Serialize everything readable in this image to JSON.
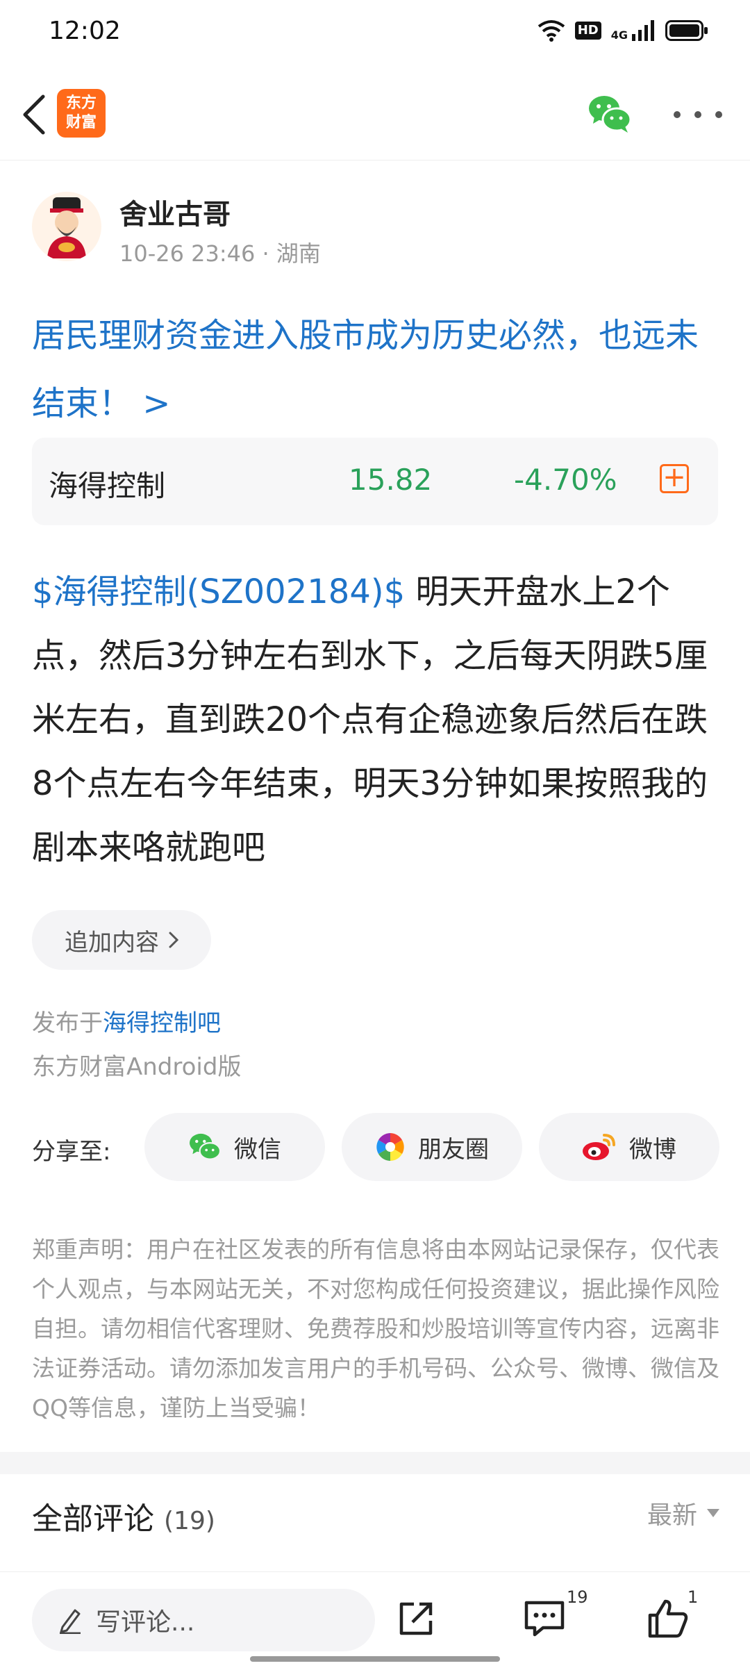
{
  "status_bar": {
    "time": "12:02",
    "hd": "HD",
    "network": "4G"
  },
  "header": {
    "logo_line1": "东方",
    "logo_line2": "财富"
  },
  "author": {
    "name": "舍业古哥",
    "meta": "10-26 23:46 · 湖南"
  },
  "post": {
    "title": "居民理财资金进入股市成为历史必然，也远未结束！ >",
    "stock_link": "$海得控制(SZ002184)$",
    "body": " 明天开盘水上2个点，然后3分钟左右到水下，之后每天阴跌5厘米左右，直到跌20个点有企稳迹象后然后在跌8个点左右今年结束，明天3分钟如果按照我的剧本来咯就跑吧"
  },
  "stock_card": {
    "name": "海得控制",
    "price": "15.82",
    "change": "-4.70%",
    "add_symbol": "+"
  },
  "append_label": "追加内容",
  "posted_in": {
    "prefix": "发布于",
    "bar": "海得控制吧"
  },
  "client": "东方财富Android版",
  "share": {
    "label": "分享至:",
    "wechat": "微信",
    "moments": "朋友圈",
    "weibo": "微博"
  },
  "disclaimer": "郑重声明：用户在社区发表的所有信息将由本网站记录保存，仅代表个人观点，与本网站无关，不对您构成任何投资建议，据此操作风险自担。请勿相信代客理财、免费荐股和炒股培训等宣传内容，远离非法证券活动。请勿添加发言用户的手机号码、公众号、微博、微信及QQ等信息，谨防上当受骗！",
  "comments": {
    "title": "全部评论",
    "count": "(19)",
    "sort": "最新"
  },
  "bottom_bar": {
    "input_placeholder": "写评论...",
    "comment_count": "19",
    "like_count": "1"
  },
  "colors": {
    "accent_blue": "#1e73c8",
    "down_green": "#2aa15a",
    "brand_orange": "#ff6a1a"
  }
}
